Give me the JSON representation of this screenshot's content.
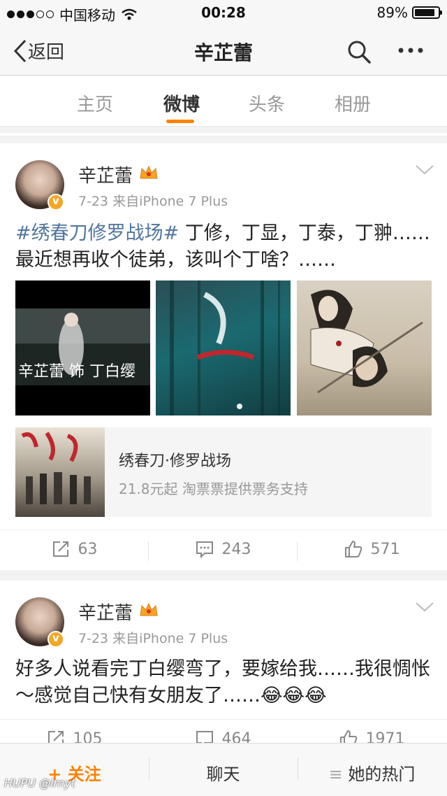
{
  "status_bar": {
    "carrier": "中国移动",
    "time": "00:28",
    "battery": "89%",
    "battery_level": 0.89
  },
  "nav": {
    "back_label": "返回",
    "title": "辛芷蕾"
  },
  "tabs": [
    {
      "label": "主页",
      "active": false
    },
    {
      "label": "微博",
      "active": true
    },
    {
      "label": "头条",
      "active": false
    },
    {
      "label": "相册",
      "active": false
    }
  ],
  "posts": [
    {
      "author": "辛芷蕾",
      "meta": "7-23  来自iPhone 7 Plus",
      "hashtag": "#绣春刀修罗战场#",
      "text": " 丁修，丁显，丁泰，丁翀……最近想再收个徒弟，该叫个丁啥？……",
      "images": [
        {
          "caption": "辛芷蕾 饰 丁白缨"
        },
        {
          "caption": ""
        },
        {
          "caption": ""
        }
      ],
      "card": {
        "title": "绣春刀·修罗战场",
        "subtitle": "21.8元起 淘票票提供票务支持"
      },
      "actions": {
        "repost": "63",
        "comment": "243",
        "like": "571"
      }
    },
    {
      "author": "辛芷蕾",
      "meta": "7-23  来自iPhone 7 Plus",
      "text": "好多人说看完丁白缨弯了，要嫁给我……我很惆怅～感觉自己快有女朋友了……",
      "emoji": "😂😂😂",
      "actions": {
        "repost": "105",
        "comment": "464",
        "like": "1971"
      }
    }
  ],
  "bottom_bar": {
    "follow": "关注",
    "chat": "聊天",
    "hot": "她的热门"
  },
  "watermark": "HUPU @lmyt",
  "colors": {
    "accent": "#ff8200",
    "link": "#50759e"
  }
}
